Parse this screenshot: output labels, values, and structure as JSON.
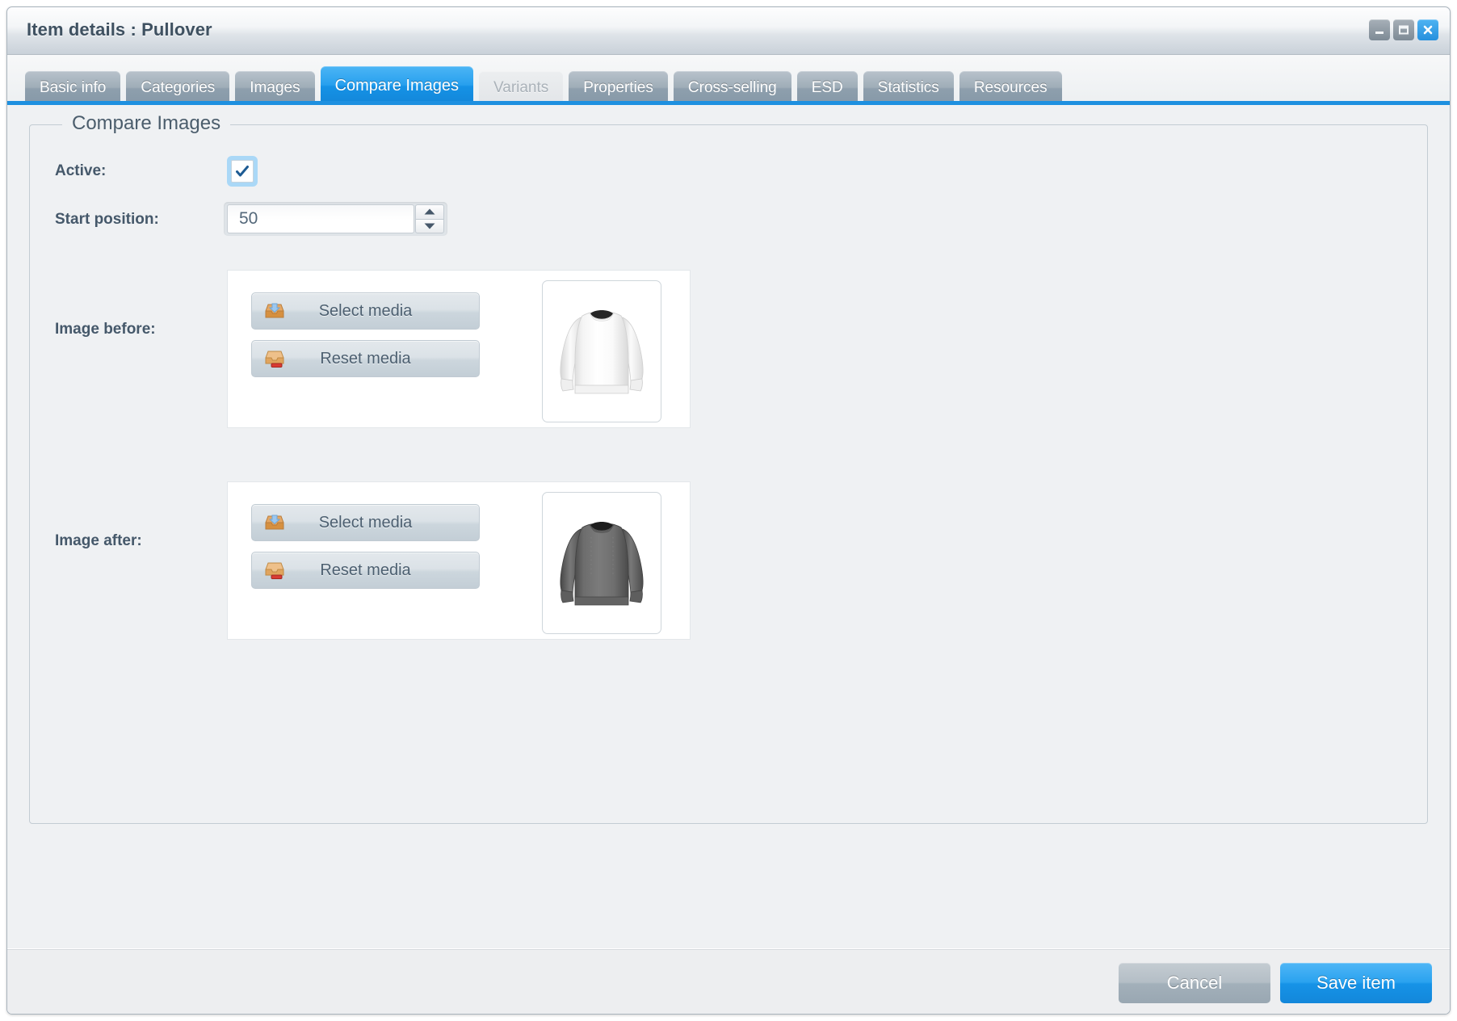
{
  "window": {
    "title": "Item details : Pullover",
    "controls": [
      {
        "name": "minimize-button",
        "icon": "minimize-icon"
      },
      {
        "name": "maximize-button",
        "icon": "maximize-icon"
      },
      {
        "name": "close-button",
        "icon": "close-icon"
      }
    ]
  },
  "tabs": [
    {
      "label": "Basic info",
      "state": "normal"
    },
    {
      "label": "Categories",
      "state": "normal"
    },
    {
      "label": "Images",
      "state": "normal"
    },
    {
      "label": "Compare Images",
      "state": "active"
    },
    {
      "label": "Variants",
      "state": "disabled"
    },
    {
      "label": "Properties",
      "state": "normal"
    },
    {
      "label": "Cross-selling",
      "state": "normal"
    },
    {
      "label": "ESD",
      "state": "normal"
    },
    {
      "label": "Statistics",
      "state": "normal"
    },
    {
      "label": "Resources",
      "state": "normal"
    }
  ],
  "panel": {
    "legend": "Compare Images",
    "fields": {
      "active": {
        "label": "Active:",
        "checked": true,
        "checkbox_icon": "checkmark-icon"
      },
      "start_position": {
        "label": "Start position:",
        "value": "50",
        "placeholder": "",
        "spinner_up_icon": "triangle-up-icon",
        "spinner_down_icon": "triangle-down-icon"
      },
      "image_before": {
        "label": "Image before:",
        "select_button": "Select media",
        "reset_button": "Reset media",
        "select_icon": "inbox-tray-in-icon",
        "reset_icon": "inbox-tray-delete-icon",
        "thumbnail_alt": "white-pullover-thumbnail"
      },
      "image_after": {
        "label": "Image after:",
        "select_button": "Select media",
        "reset_button": "Reset media",
        "select_icon": "inbox-tray-in-icon",
        "reset_icon": "inbox-tray-delete-icon",
        "thumbnail_alt": "dark-grey-pullover-thumbnail"
      }
    }
  },
  "footer": {
    "cancel_label": "Cancel",
    "save_label": "Save item"
  },
  "colors": {
    "accent_blue": "#1e90e0",
    "tab_grey": "#8e9fad",
    "label_text": "#45586a",
    "legend_text": "#4b5d6c"
  }
}
